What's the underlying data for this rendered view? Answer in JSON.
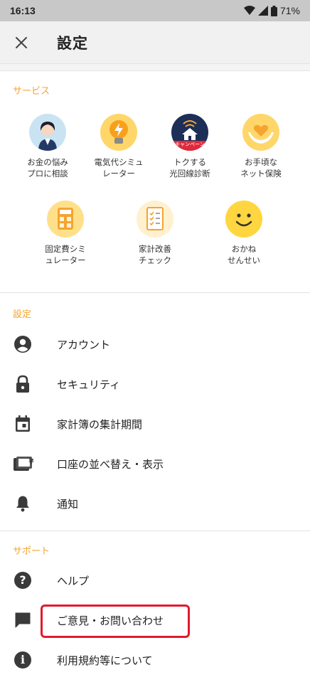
{
  "status_bar": {
    "time": "16:13",
    "battery": "71%"
  },
  "header": {
    "title": "設定"
  },
  "services": {
    "label": "サービス",
    "items": [
      {
        "line1": "お金の悩み",
        "line2": "プロに相談",
        "icon": "advisor-icon"
      },
      {
        "line1": "電気代シミュ",
        "line2": "レーター",
        "icon": "lightbulb-icon"
      },
      {
        "line1": "トクする",
        "line2": "光回線診断",
        "icon": "house-wifi-icon",
        "badge": "キャンペーン"
      },
      {
        "line1": "お手頃な",
        "line2": "ネット保険",
        "icon": "heart-hands-icon"
      },
      {
        "line1": "固定費シミ",
        "line2": "ュレーター",
        "icon": "calculator-icon"
      },
      {
        "line1": "家計改善",
        "line2": "チェック",
        "icon": "checklist-icon"
      },
      {
        "line1": "おかね",
        "line2": "せんせい",
        "icon": "smiley-icon"
      }
    ]
  },
  "settings": {
    "label": "設定",
    "items": [
      {
        "label": "アカウント",
        "icon": "account-icon"
      },
      {
        "label": "セキュリティ",
        "icon": "lock-icon"
      },
      {
        "label": "家計簿の集計期間",
        "icon": "calendar-icon"
      },
      {
        "label": "口座の並べ替え・表示",
        "icon": "wallet-icon",
        "glyph": "¥"
      },
      {
        "label": "通知",
        "icon": "bell-icon"
      }
    ]
  },
  "support": {
    "label": "サポート",
    "items": [
      {
        "label": "ヘルプ",
        "icon": "help-icon",
        "glyph": "?"
      },
      {
        "label": "ご意見・お問い合わせ",
        "icon": "feedback-icon"
      },
      {
        "label": "利用規約等について",
        "icon": "info-icon",
        "glyph": "i"
      }
    ]
  },
  "colors": {
    "accent": "#f5a430",
    "highlight": "#e21a2c",
    "icon": "#3a3a3a"
  }
}
